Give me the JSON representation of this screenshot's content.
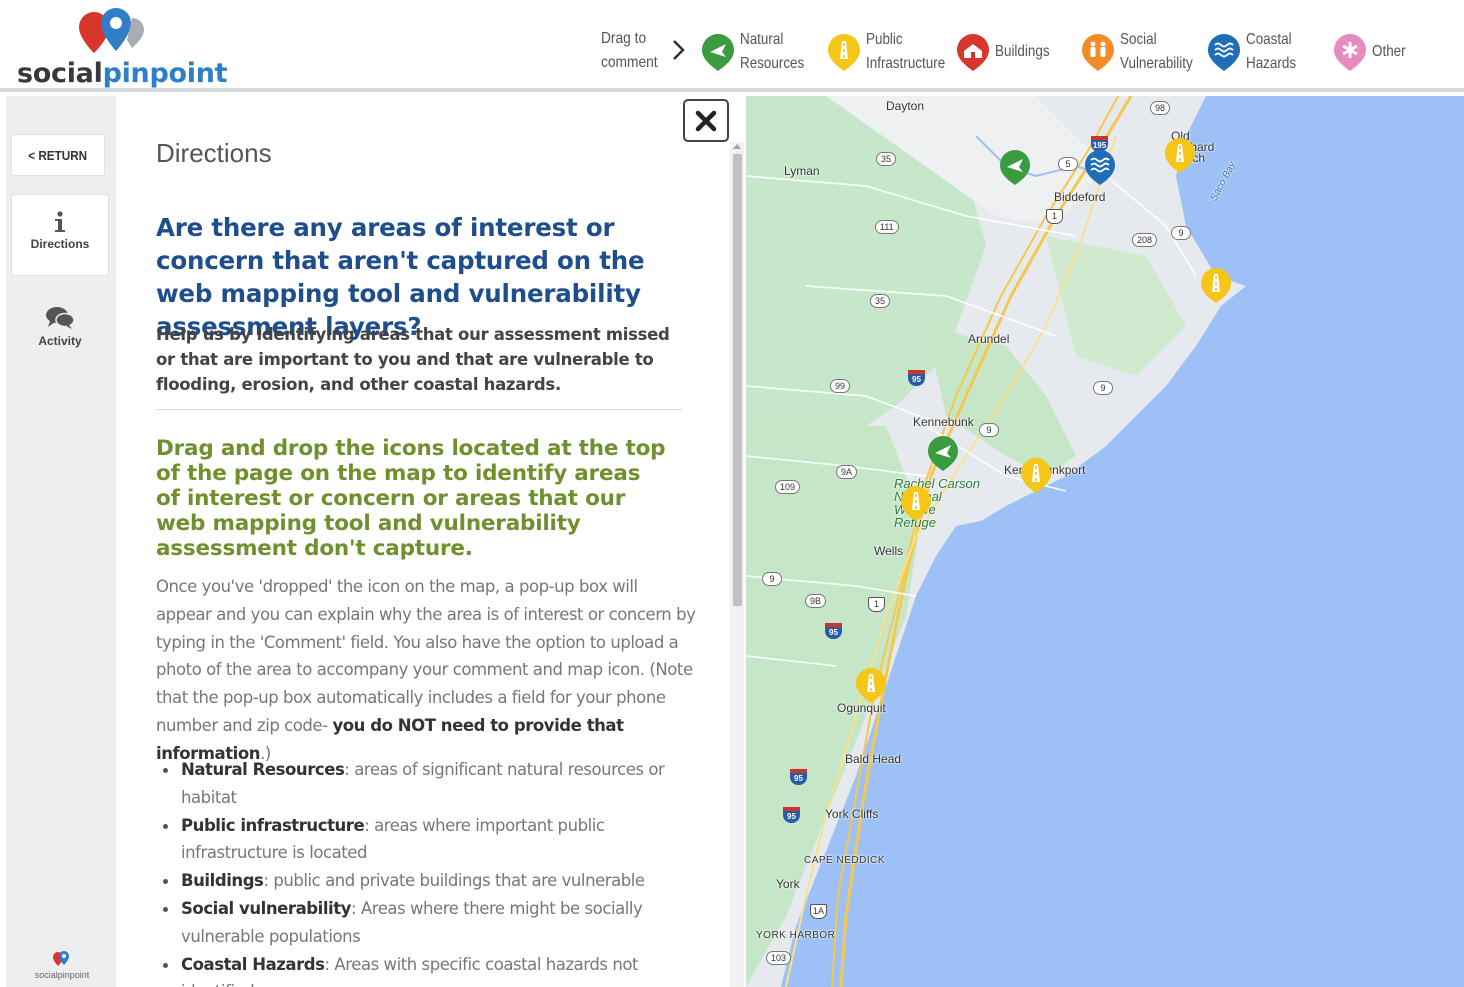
{
  "logo": {
    "text_a": "social",
    "text_b": "pinpoint"
  },
  "toolbar": {
    "drag_label": "Drag to comment",
    "categories": [
      {
        "label": "Natural\nResources",
        "color": "#3a9b3f",
        "icon": "bird-icon"
      },
      {
        "label": "Public\nInfrastructure",
        "color": "#f5c518",
        "icon": "road-icon"
      },
      {
        "label": "Buildings",
        "color": "#d9362b",
        "icon": "house-icon"
      },
      {
        "label": "Social\nVulnerability",
        "color": "#f28c28",
        "icon": "people-icon"
      },
      {
        "label": "Coastal\nHazards",
        "color": "#1f6fb8",
        "icon": "waves-icon"
      },
      {
        "label": "Other",
        "color": "#e58cc0",
        "icon": "asterisk-icon"
      }
    ]
  },
  "rail": {
    "return_label": "< RETURN",
    "directions_label": "Directions",
    "activity_label": "Activity",
    "footer_label": "socialpinpoint"
  },
  "panel": {
    "title": "Directions",
    "heading": "Are there any areas of interest or concern that aren't captured on the web mapping tool and vulnerability assessment layers?",
    "intro": "Help us by identifying areas that our assessment missed or that are important to you and that are vulnerable to flooding, erosion, and other coastal hazards.",
    "subheading": "Drag and drop the icons located at the top of the page on the map to identify areas of interest or concern or areas that our web mapping tool and vulnerability assessment don't capture.",
    "body_part1": "Once you've 'dropped' the icon on the map, a pop-up box will appear and you can explain why the area is of interest or concern by typing in the 'Comment' field. You also have the option to upload a photo of the area to accompany your comment and map icon. (Note that the pop-up box automatically includes a field for your phone number and zip code- ",
    "body_bold": "you do NOT need to provide that information",
    "body_part2": ".)",
    "bullets": [
      {
        "term": "Natural Resources",
        "desc": ": areas of significant natural resources or habitat"
      },
      {
        "term": "Public infrastructure",
        "desc": ": areas where important public infrastructure is located"
      },
      {
        "term": "Buildings",
        "desc": ": public and private buildings that are vulnerable"
      },
      {
        "term": "Social vulnerability",
        "desc": ": Areas where there might be socially vulnerable populations"
      },
      {
        "term": "Coastal Hazards",
        "desc": ": Areas with specific coastal hazards not identified"
      }
    ]
  },
  "map": {
    "places": [
      "Dayton",
      "Lyman",
      "Biddeford",
      "Old Orchard Beach",
      "Arundel",
      "Kennebunk",
      "Kennebunkport",
      "Wells",
      "Ogunquit",
      "Bald Head",
      "York Cliffs",
      "CAPE NEDDICK",
      "York",
      "YORK HARBOR",
      "Saco Bay"
    ],
    "park_label": [
      "Rachel Carson",
      "National",
      "Wildlife",
      "Refuge"
    ],
    "routes": [
      "35",
      "111",
      "35",
      "99",
      "9",
      "9",
      "9A",
      "109",
      "9",
      "9B",
      "1",
      "1",
      "5",
      "208",
      "98",
      "1",
      "1A",
      "103"
    ],
    "interstates": [
      "195",
      "95",
      "95",
      "95",
      "95"
    ]
  }
}
